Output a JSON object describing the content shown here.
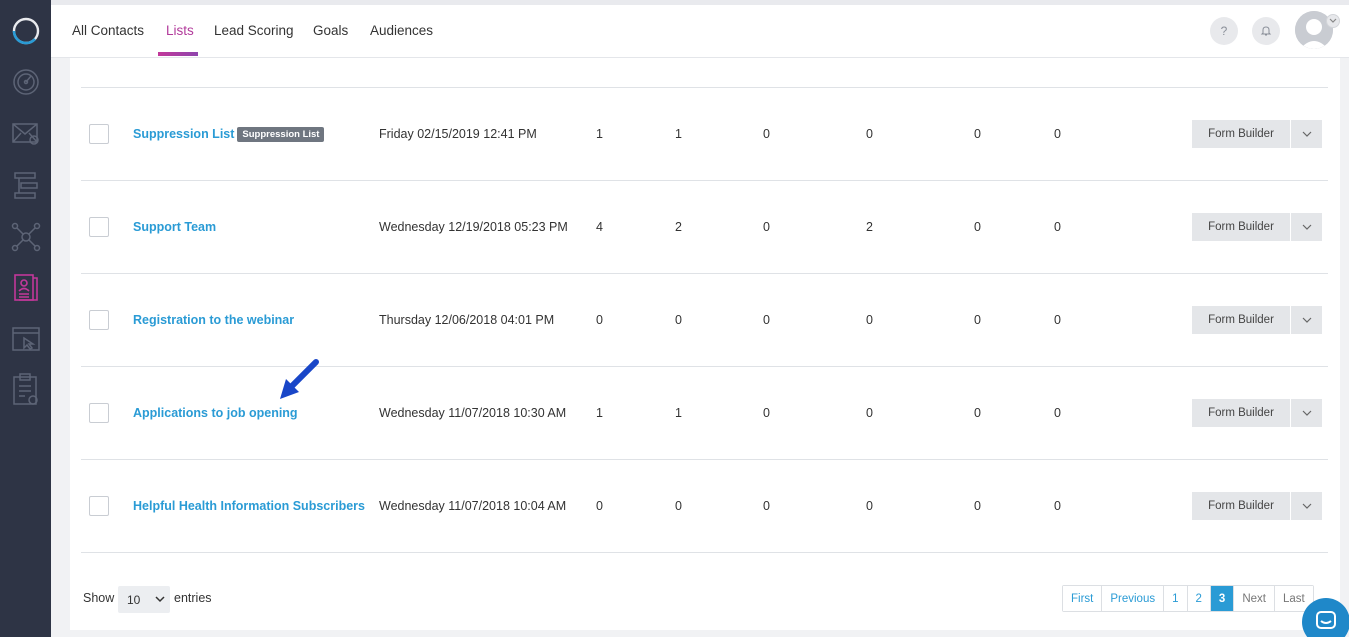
{
  "nav": {
    "tabs": [
      "All Contacts",
      "Lists",
      "Lead Scoring",
      "Goals",
      "Audiences"
    ],
    "active_tab": "Lists",
    "help_label": "?"
  },
  "sidebar": {
    "icons": [
      "logo-icon",
      "dashboard-icon",
      "email-icon",
      "automation-icon",
      "network-icon",
      "contacts-icon",
      "landing-page-icon",
      "forms-icon"
    ],
    "active_index": 5,
    "accent_color": "#c2389a"
  },
  "table": {
    "rows": [
      {
        "name": "Suppression List",
        "badge": "Suppression List",
        "date": "Friday 02/15/2019 12:41 PM",
        "values": [
          "1",
          "1",
          "0",
          "0",
          "0",
          "0"
        ]
      },
      {
        "name": "Support Team",
        "badge": "",
        "date": "Wednesday 12/19/2018 05:23 PM",
        "values": [
          "4",
          "2",
          "0",
          "2",
          "0",
          "0"
        ]
      },
      {
        "name": "Registration to the webinar",
        "badge": "",
        "date": "Thursday 12/06/2018 04:01 PM",
        "values": [
          "0",
          "0",
          "0",
          "0",
          "0",
          "0"
        ]
      },
      {
        "name": "Applications to job opening",
        "badge": "",
        "date": "Wednesday 11/07/2018 10:30 AM",
        "values": [
          "1",
          "1",
          "0",
          "0",
          "0",
          "0"
        ]
      },
      {
        "name": "Helpful Health Information Subscribers",
        "badge": "",
        "date": "Wednesday 11/07/2018 10:04 AM",
        "values": [
          "0",
          "0",
          "0",
          "0",
          "0",
          "0"
        ]
      }
    ],
    "action_label": "Form Builder"
  },
  "footer": {
    "show_label": "Show",
    "entries_value": "10",
    "entries_label": "entries",
    "pagination": [
      "First",
      "Previous",
      "1",
      "2",
      "3",
      "Next",
      "Last"
    ],
    "active_page": "3"
  },
  "colors": {
    "link": "#2a9bd5",
    "active_tab": "#b23a9b",
    "sidebar_bg": "#2e3445"
  }
}
